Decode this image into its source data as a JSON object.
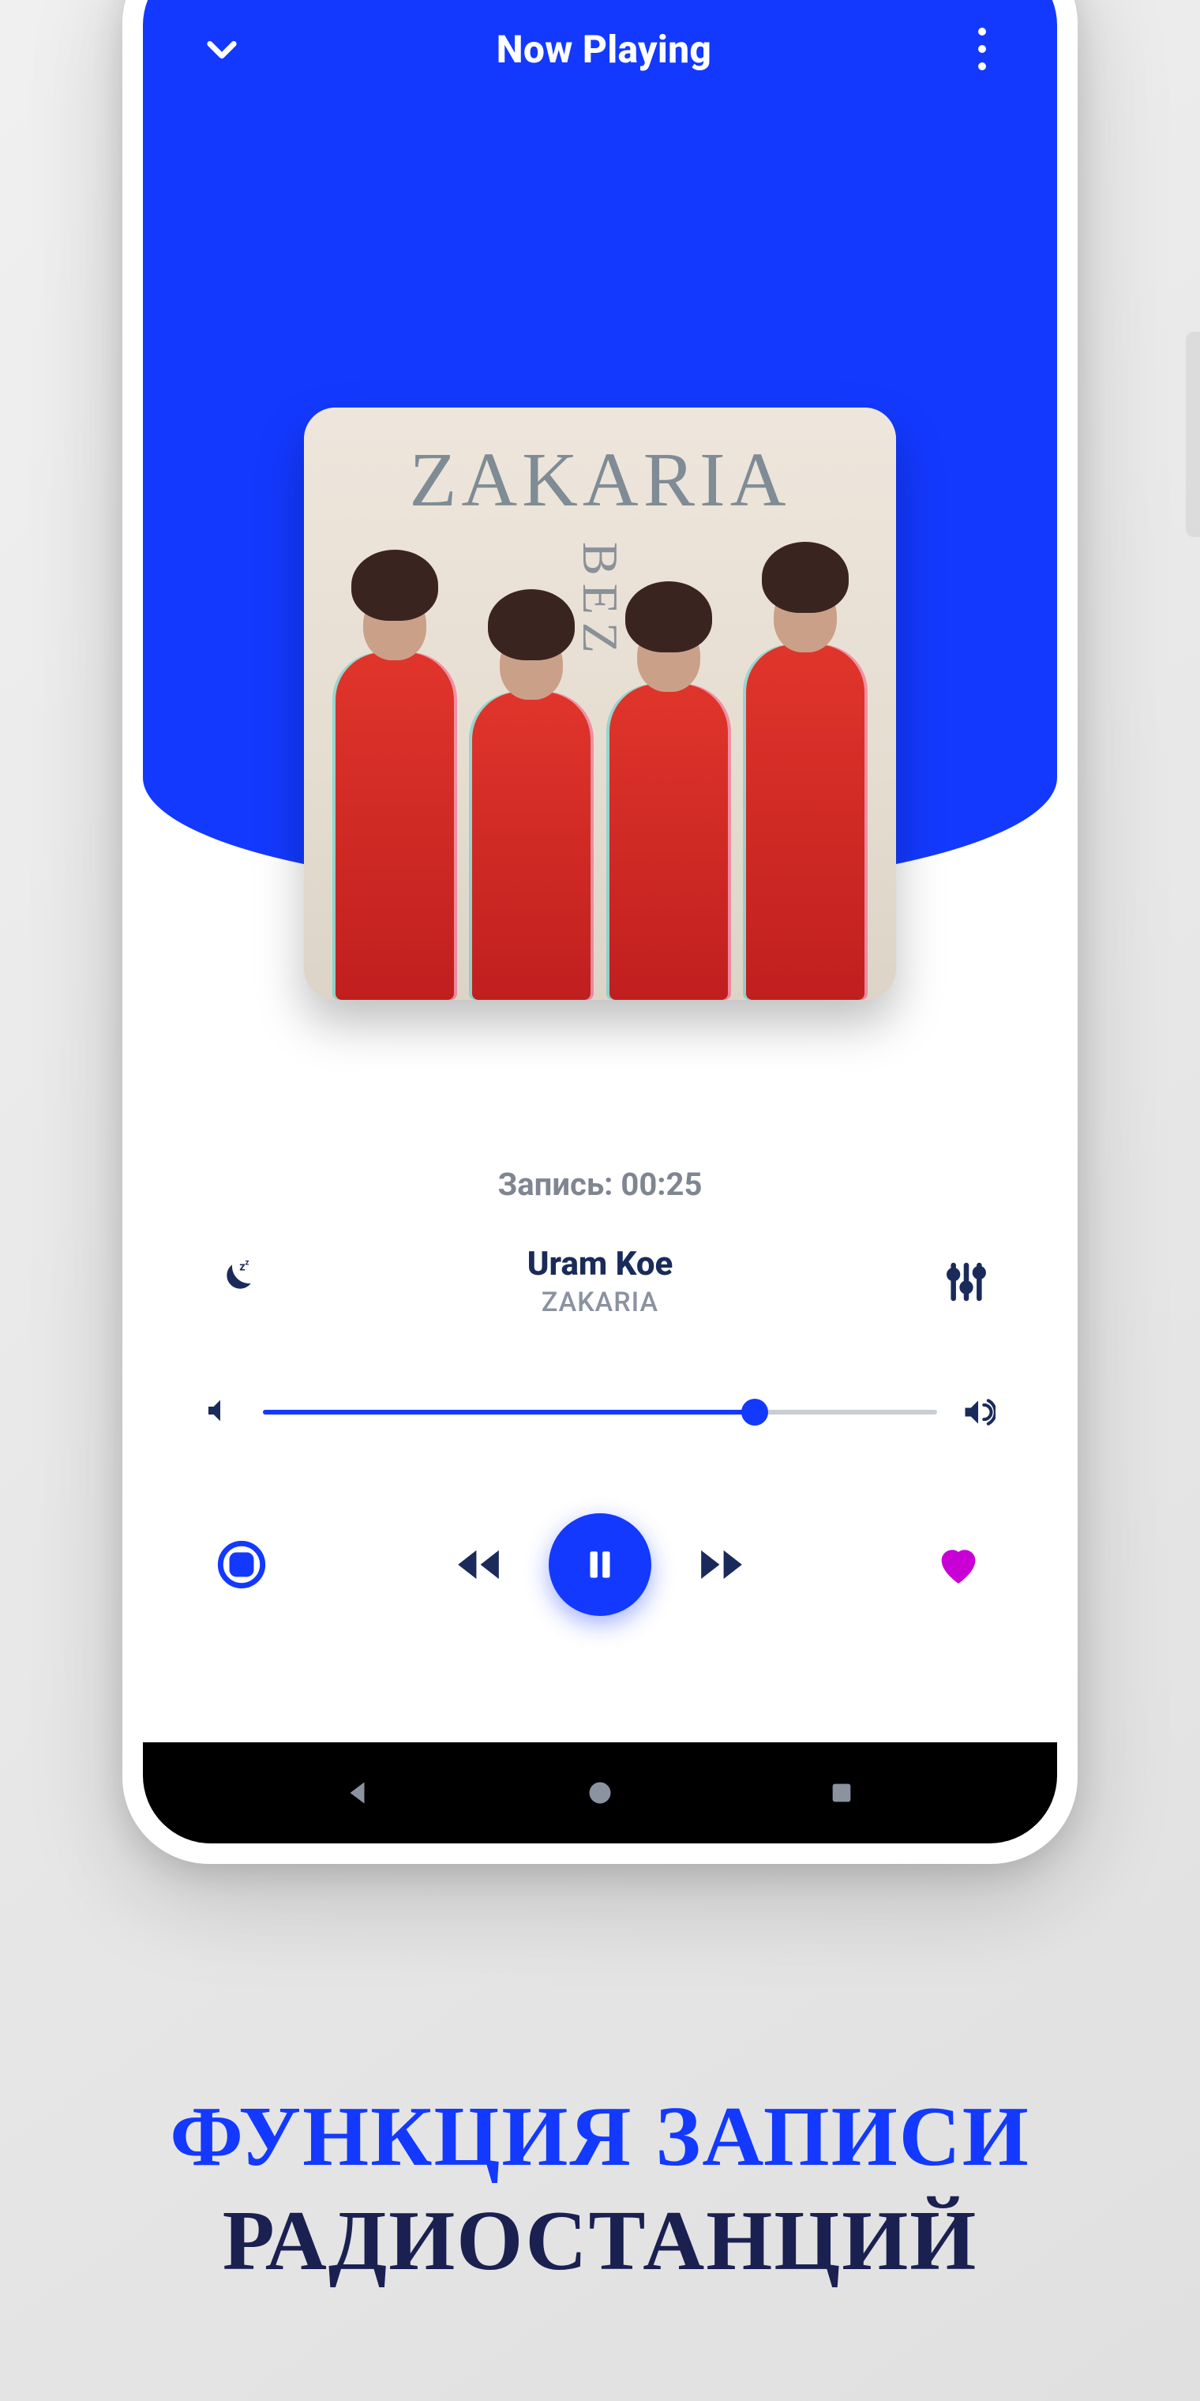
{
  "header": {
    "title": "Now Playing"
  },
  "album": {
    "line1": "ZAKARIA",
    "line2": "BEZ"
  },
  "recording": {
    "label": "Запись: 00:25"
  },
  "track": {
    "title": "Uram Koe",
    "artist": "ZAKARIA"
  },
  "volume": {
    "percent": 73
  },
  "caption": {
    "line1": "ФУНКЦИЯ ЗАПИСИ",
    "line2": "РАДИОСТАНЦИЙ"
  }
}
